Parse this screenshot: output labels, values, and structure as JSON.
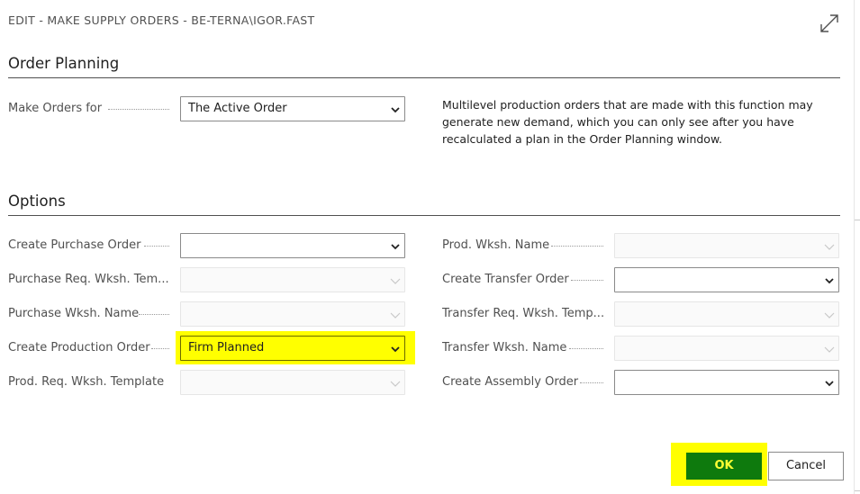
{
  "dialog": {
    "title": "EDIT - MAKE SUPPLY ORDERS - BE-TERNA\\IGOR.FAST",
    "expand_icon": "expand-diagonal-arrow-icon"
  },
  "order_planning": {
    "heading": "Order Planning",
    "make_orders_for": {
      "label": "Make Orders for",
      "value": "The Active Order"
    },
    "info": "Multilevel production orders that are made with this function may generate new demand, which you can only see after you have recalculated a plan in the Order Planning window."
  },
  "options": {
    "heading": "Options",
    "left": [
      {
        "label": "Create Purchase Order",
        "value": "",
        "enabled": true
      },
      {
        "label": "Purchase Req. Wksh. Tem...",
        "value": "",
        "enabled": false
      },
      {
        "label": "Purchase Wksh. Name",
        "value": "",
        "enabled": false
      },
      {
        "label": "Create Production Order",
        "value": "Firm Planned",
        "enabled": true,
        "highlighted": true
      },
      {
        "label": "Prod. Req. Wksh. Template",
        "value": "",
        "enabled": false
      }
    ],
    "right": [
      {
        "label": "Prod. Wksh. Name",
        "value": "",
        "enabled": false
      },
      {
        "label": "Create Transfer Order",
        "value": "",
        "enabled": true
      },
      {
        "label": "Transfer Req. Wksh. Temp...",
        "value": "",
        "enabled": false
      },
      {
        "label": "Transfer Wksh. Name",
        "value": "",
        "enabled": false
      },
      {
        "label": "Create Assembly Order",
        "value": "",
        "enabled": true
      }
    ]
  },
  "buttons": {
    "ok": "OK",
    "cancel": "Cancel"
  },
  "colors": {
    "ok_bg": "#0e7a0d",
    "ok_text": "#ffff33",
    "highlight": "#ffff00"
  }
}
